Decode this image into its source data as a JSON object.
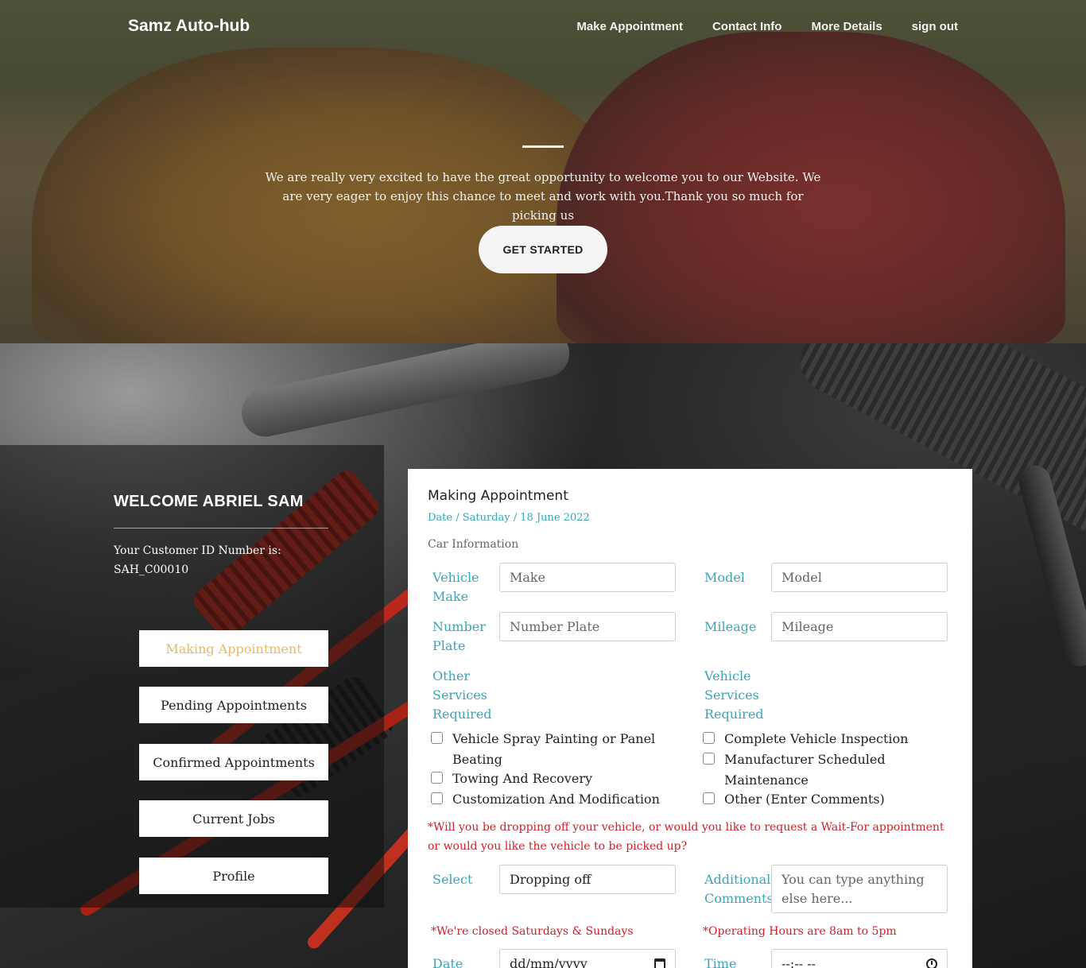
{
  "header": {
    "brand": "Samz Auto-hub",
    "nav": [
      "Make Appointment",
      "Contact Info",
      "More Details",
      "sign out"
    ]
  },
  "hero": {
    "text": "We are really very excited to have the great opportunity to welcome you to our Website. We are very eager to enjoy this chance to meet and work with you.Thank you so much for picking us",
    "cta": "GET STARTED"
  },
  "sidebar": {
    "welcome": "WELCOME ABRIEL SAM",
    "id_label": "Your Customer ID Number is:",
    "id_value": "SAH_C00010",
    "buttons": [
      "Making Appointment",
      "Pending Appointments",
      "Confirmed Appointments",
      "Current Jobs",
      "Profile"
    ],
    "active": "Making Appointment"
  },
  "form": {
    "title": "Making Appointment",
    "date_line": "Date / Saturday / 18 June 2022",
    "section": "Car Information",
    "labels": {
      "vehicle_make": "Vehicle Make",
      "model": "Model",
      "number_plate": "Number Plate",
      "mileage": "Mileage",
      "other_services": "Other Services Required",
      "vehicle_services": "Vehicle Services Required",
      "select": "Select",
      "additional": "Additional Comments",
      "date": "Date",
      "time": "Time"
    },
    "placeholders": {
      "make": "Make",
      "model": "Model",
      "plate": "Number Plate",
      "mileage": "Mileage",
      "comments": "You can type anything else here..."
    },
    "other_services": [
      "Vehicle Spray Painting or Panel Beating",
      "Towing And Recovery",
      "Customization And Modification"
    ],
    "vehicle_services": [
      "Complete Vehicle Inspection",
      "Manufacturer Scheduled Maintenance",
      "Other (Enter Comments)"
    ],
    "dropoff_question": "*Will you be dropping off your vehicle, or would you like to request a Wait-For appointment or would you like the vehicle to be picked up?",
    "select_value": "Dropping off",
    "closed_note": "*We're closed Saturdays & Sundays",
    "hours_note": "*Operating Hours are 8am to 5pm",
    "date_value": "dd/mm/yyyy",
    "time_value": "--:-- --"
  },
  "colors": {
    "accent": "#3aa6b9",
    "warning": "#d0202a",
    "active_button": "#e9b86a"
  }
}
